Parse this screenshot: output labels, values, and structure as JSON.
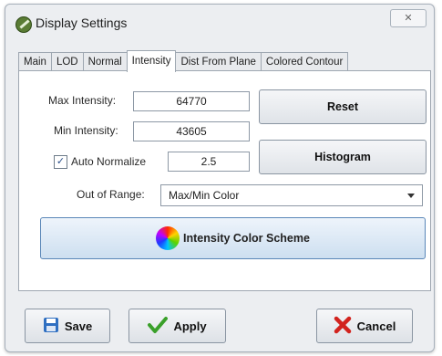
{
  "window": {
    "title": "Display Settings",
    "close_glyph": "✕"
  },
  "tabs": [
    {
      "label": "Main"
    },
    {
      "label": "LOD"
    },
    {
      "label": "Normal"
    },
    {
      "label": "Intensity",
      "active": true
    },
    {
      "label": "Dist From Plane"
    },
    {
      "label": "Colored Contour"
    }
  ],
  "intensity": {
    "max_label": "Max Intensity:",
    "max_value": "64770",
    "min_label": "Min Intensity:",
    "min_value": "43605",
    "auto_normalize_label": "Auto Normalize",
    "auto_normalize_checked": true,
    "auto_normalize_value": "2.5",
    "out_of_range_label": "Out of Range:",
    "out_of_range_value": "Max/Min Color",
    "reset_label": "Reset",
    "histogram_label": "Histogram",
    "color_scheme_label": "Intensity Color Scheme"
  },
  "footer": {
    "save_label": "Save",
    "apply_label": "Apply",
    "cancel_label": "Cancel"
  },
  "icons": {
    "app": "leaf-icon",
    "save": "floppy-disk-icon",
    "apply": "checkmark-icon",
    "cancel": "x-icon",
    "color_scheme": "color-wheel-icon"
  },
  "colors": {
    "apply_check": "#3aa02a",
    "cancel_x": "#d2231e",
    "save_disk": "#2f6fc1"
  }
}
